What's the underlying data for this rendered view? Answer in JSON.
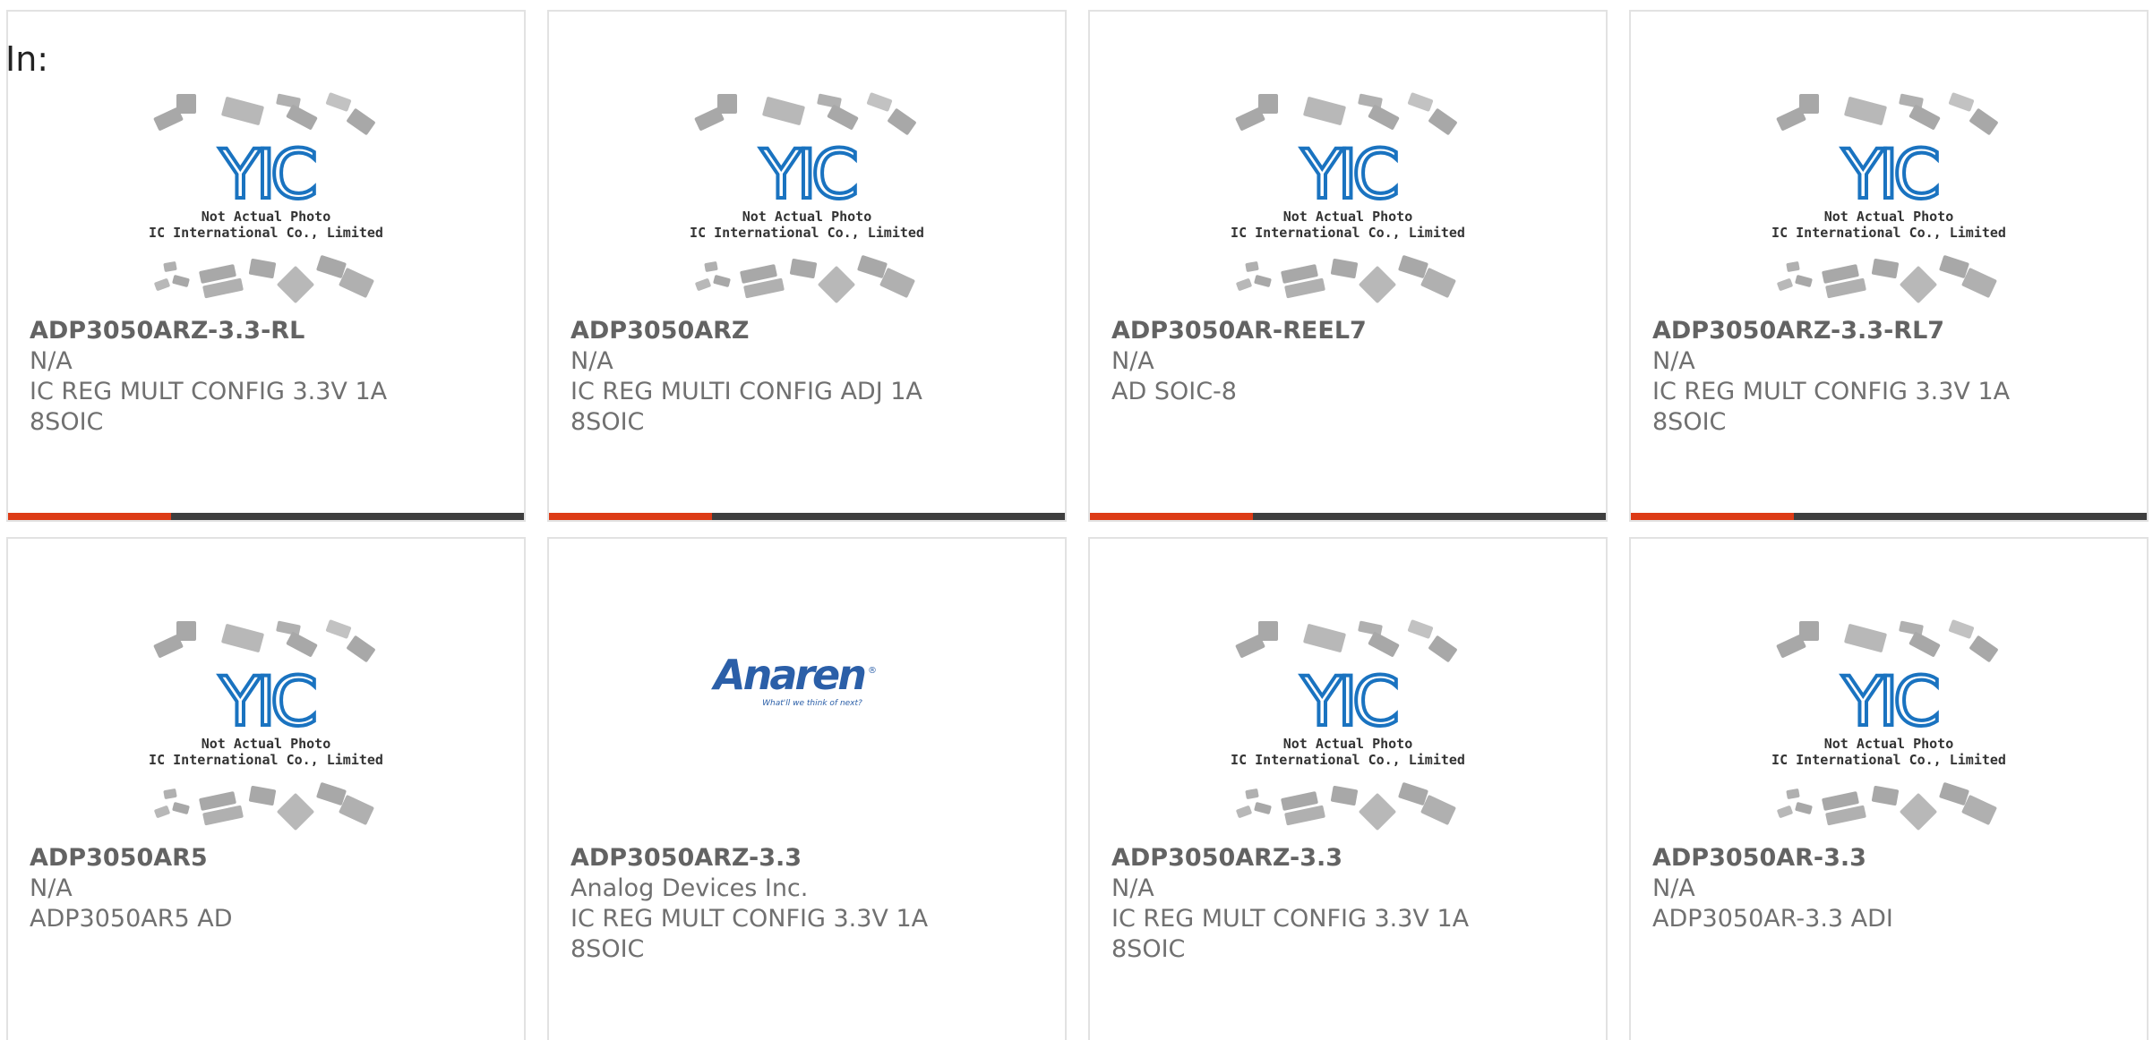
{
  "header": {
    "in_label": "In:"
  },
  "placeholder_photo": {
    "line1": "Not Actual Photo",
    "line2": "YIC International Co., Limited.",
    "logo_text": "YIC"
  },
  "anaren_logo": {
    "name": "Anaren",
    "registered": "®",
    "tagline": "What'll we think of next?"
  },
  "colors": {
    "accent": "#dd3b16",
    "bar": "#3e3e3e",
    "yic_blue": "#1a73c0",
    "anaren_blue": "#2b5fa8"
  },
  "products": [
    {
      "part": "ADP3050ARZ-3.3-RL",
      "manufacturer": "N/A",
      "description": "IC REG MULT CONFIG 3.3V 1A 8SOIC",
      "image": "yic-placeholder"
    },
    {
      "part": "ADP3050ARZ",
      "manufacturer": "N/A",
      "description": "IC REG MULTI CONFIG ADJ 1A 8SOIC",
      "image": "yic-placeholder"
    },
    {
      "part": "ADP3050AR-REEL7",
      "manufacturer": "N/A",
      "description": "AD SOIC-8",
      "image": "yic-placeholder"
    },
    {
      "part": "ADP3050ARZ-3.3-RL7",
      "manufacturer": "N/A",
      "description": "IC REG MULT CONFIG 3.3V 1A 8SOIC",
      "image": "yic-placeholder"
    },
    {
      "part": "ADP3050AR5",
      "manufacturer": "N/A",
      "description": "ADP3050AR5 AD",
      "image": "yic-placeholder"
    },
    {
      "part": "ADP3050ARZ-3.3",
      "manufacturer": "Analog Devices Inc.",
      "description": "IC REG MULT CONFIG 3.3V 1A 8SOIC",
      "image": "anaren-logo"
    },
    {
      "part": "ADP3050ARZ-3.3",
      "manufacturer": "N/A",
      "description": "IC REG MULT CONFIG 3.3V 1A 8SOIC",
      "image": "yic-placeholder"
    },
    {
      "part": "ADP3050AR-3.3",
      "manufacturer": "N/A",
      "description": "ADP3050AR-3.3 ADI",
      "image": "yic-placeholder"
    }
  ]
}
